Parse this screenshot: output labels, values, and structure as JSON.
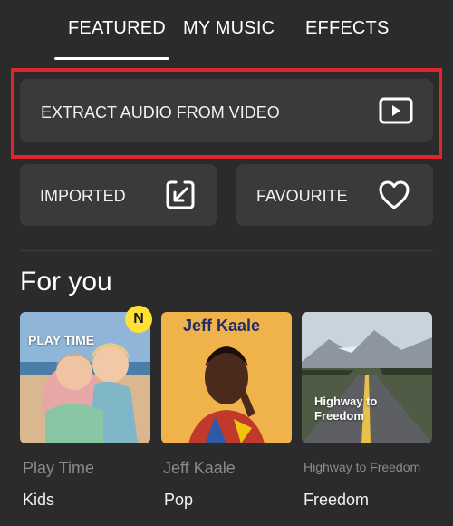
{
  "tabs": [
    {
      "label": "FEATURED",
      "active": true
    },
    {
      "label": "MY MUSIC",
      "active": false
    },
    {
      "label": "EFFECTS",
      "active": false
    }
  ],
  "actions": {
    "extract": {
      "label": "EXTRACT AUDIO FROM VIDEO",
      "icon": "play-video-icon"
    },
    "imported": {
      "label": "IMPORTED",
      "icon": "import-arrow-icon"
    },
    "favourite": {
      "label": "FAVOURITE",
      "icon": "heart-icon"
    }
  },
  "highlight_color": "#e0252b",
  "section_title": "For you",
  "tiles": [
    {
      "cover_text": "PLAY TIME",
      "badge": "N",
      "title": "Play Time",
      "genre": "Kids"
    },
    {
      "cover_text": "Jeff Kaale",
      "title": "Jeff Kaale",
      "genre": "Pop"
    },
    {
      "cover_text": "Highway to Freedom",
      "title": "Highway to Freedom",
      "genre": "Freedom"
    }
  ],
  "colors": {
    "background": "#2b2b2b",
    "card": "#3a3a3a",
    "badge": "#ffe033",
    "muted_text": "#8a8a8a"
  }
}
